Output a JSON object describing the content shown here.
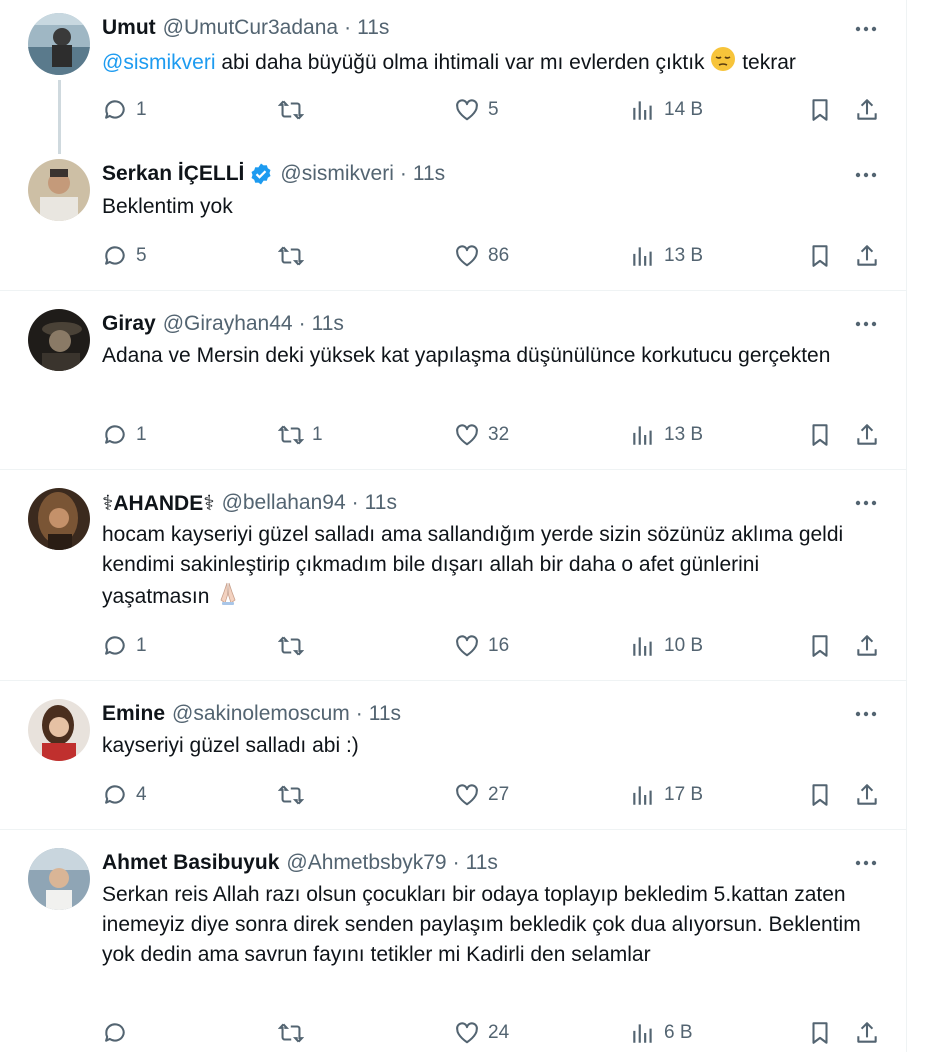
{
  "tweets": [
    {
      "name": "Umut",
      "handle": "@UmutCur3adana",
      "sep": "·",
      "time": "11s",
      "mention": "@sismikveri",
      "text": " abi daha büyüğü olma ihtimali var mı evlerden çıktık ",
      "emoji": "pensive-face-emoji",
      "text_after": " tekrar",
      "replies": "1",
      "retweets": "",
      "likes": "5",
      "views": "14 B",
      "avatar_color": "#5a7a8c"
    },
    {
      "name": "Serkan İÇELLİ",
      "verified": true,
      "handle": "@sismikveri",
      "sep": "·",
      "time": "11s",
      "text": "Beklentim yok",
      "replies": "5",
      "retweets": "",
      "likes": "86",
      "views": "13 B",
      "avatar_color": "#8a8070"
    },
    {
      "name": "Giray",
      "handle": "@Girayhan44",
      "sep": "·",
      "time": "11s",
      "text": "Adana ve Mersin deki yüksek kat yapılaşma düşünülünce korkutucu gerçekten",
      "replies": "1",
      "retweets": "1",
      "likes": "32",
      "views": "13 B",
      "avatar_color": "#2e2a24"
    },
    {
      "name": "⚕AHANDE⚕",
      "handle": "@bellahan94",
      "sep": "·",
      "time": "11s",
      "text": "hocam kayseriyi güzel salladı ama sallandığım yerde sizin sözünüz aklıma geldi kendimi sakinleştirip çıkmadım bile dışarı allah bir daha o afet günlerini yaşatmasın ",
      "emoji": "folded-hands-emoji",
      "replies": "1",
      "retweets": "",
      "likes": "16",
      "views": "10 B",
      "avatar_color": "#6b4a32"
    },
    {
      "name": "Emine",
      "handle": "@sakinolemoscum",
      "sep": "·",
      "time": "11s",
      "text": "kayseriyi güzel salladı abi :)",
      "replies": "4",
      "retweets": "",
      "likes": "27",
      "views": "17 B",
      "avatar_color": "#b0393a"
    },
    {
      "name": "Ahmet Basibuyuk",
      "handle": "@Ahmetbsbyk79",
      "sep": "·",
      "time": "11s",
      "text": "Serkan reis Allah razı olsun çocukları bir odaya toplayıp bekledim 5.kattan zaten inemeyiz diye sonra direk senden paylaşım bekledik çok dua alıyorsun. Beklentim yok dedin ama savrun fayını tetikler mi Kadirli den selamlar",
      "replies": "",
      "retweets": "",
      "likes": "24",
      "views": "6 B",
      "avatar_color": "#7a8a9a"
    }
  ],
  "colors": {
    "text": "#0f1419",
    "secondary": "#536471",
    "link": "#1d9bf0",
    "verified": "#1d9bf0"
  }
}
